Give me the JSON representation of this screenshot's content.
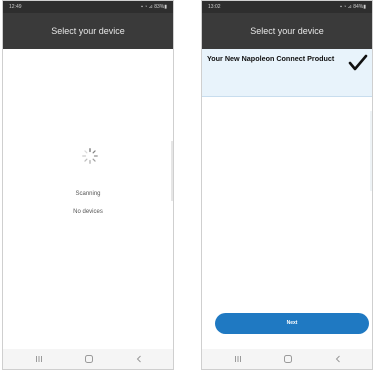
{
  "screens": [
    {
      "status": {
        "time": "12:49",
        "icons": "▪ ◔ ⊿ 83%▮"
      },
      "title": "Select your device",
      "scanning": "Scanning",
      "no_devices": "No devices"
    },
    {
      "status": {
        "time": "13:02",
        "icons": "▪ ◔ ⊿ 84%▮"
      },
      "title": "Select your device",
      "device": "Your New Napoleon Connect Product",
      "next_label": "Next"
    }
  ],
  "colors": {
    "title_bar": "#3a3a3a",
    "status_bar": "#2e2e2e",
    "accent": "#1f79c2",
    "selected_row": "#e8f3fb"
  },
  "icons": {
    "spinner": "loading-spinner-icon",
    "checkmark": "checkmark-icon",
    "nav": [
      "recents-icon",
      "home-icon",
      "back-icon"
    ]
  }
}
